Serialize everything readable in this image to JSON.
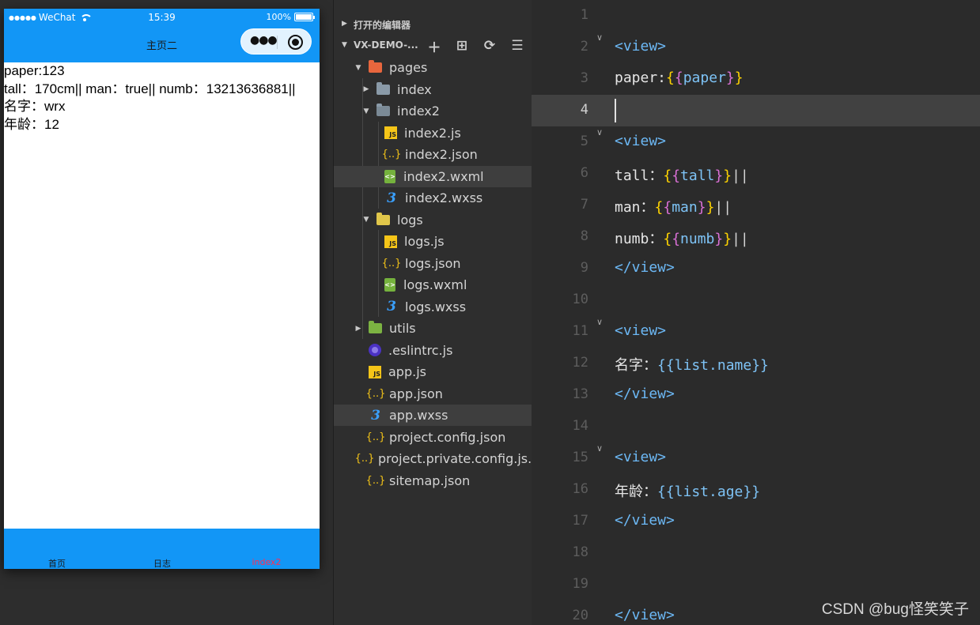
{
  "simulator": {
    "status": {
      "carrier": "WeChat",
      "time": "15:39",
      "battery": "100%"
    },
    "nav_title": "主页二",
    "content": [
      "paper:123",
      "tall：170cm|| man：true|| numb：13213636881||",
      "名字：wrx",
      "年龄：12"
    ],
    "tabs": [
      {
        "label": "首页",
        "active": false
      },
      {
        "label": "日志",
        "active": false
      },
      {
        "label": "index2",
        "active": true
      }
    ]
  },
  "explorer": {
    "section_open_editors": "打开的编辑器",
    "section_project": "VX-DEMO-...",
    "tree": [
      {
        "label": "pages",
        "icon": "folder-pages-icon",
        "depth": 1,
        "arrow": "down"
      },
      {
        "label": "index",
        "icon": "folder-icon",
        "depth": 2,
        "arrow": "right"
      },
      {
        "label": "index2",
        "icon": "folder-open-icon",
        "depth": 2,
        "arrow": "down"
      },
      {
        "label": "index2.js",
        "icon": "js-file-icon",
        "depth": 3
      },
      {
        "label": "index2.json",
        "icon": "json-file-icon",
        "depth": 3
      },
      {
        "label": "index2.wxml",
        "icon": "wxml-file-icon",
        "depth": 3,
        "selected": true
      },
      {
        "label": "index2.wxss",
        "icon": "css-file-icon",
        "depth": 3
      },
      {
        "label": "logs",
        "icon": "folder-logs-icon",
        "depth": 2,
        "arrow": "down"
      },
      {
        "label": "logs.js",
        "icon": "js-file-icon",
        "depth": 3
      },
      {
        "label": "logs.json",
        "icon": "json-file-icon",
        "depth": 3
      },
      {
        "label": "logs.wxml",
        "icon": "wxml-file-icon",
        "depth": 3
      },
      {
        "label": "logs.wxss",
        "icon": "css-file-icon",
        "depth": 3
      },
      {
        "label": "utils",
        "icon": "folder-utils-icon",
        "depth": 1,
        "arrow": "right"
      },
      {
        "label": ".eslintrc.js",
        "icon": "eslint-file-icon",
        "depth": 1
      },
      {
        "label": "app.js",
        "icon": "js-file-icon",
        "depth": 1
      },
      {
        "label": "app.json",
        "icon": "json-file-icon",
        "depth": 1
      },
      {
        "label": "app.wxss",
        "icon": "css-file-icon",
        "depth": 1,
        "hovered": true
      },
      {
        "label": "project.config.json",
        "icon": "json-file-icon",
        "depth": 1
      },
      {
        "label": "project.private.config.js...",
        "icon": "json-file-icon",
        "depth": 1
      },
      {
        "label": "sitemap.json",
        "icon": "json-file-icon",
        "depth": 1
      }
    ]
  },
  "editor": {
    "current_line": 4,
    "lines": [
      {
        "n": "1",
        "tokens": []
      },
      {
        "n": "2",
        "fold": true,
        "tokens": [
          [
            "tag",
            "<view>"
          ]
        ]
      },
      {
        "n": "3",
        "tokens": [
          [
            "txt",
            "paper:"
          ],
          [
            "b1",
            "{"
          ],
          [
            "b2",
            "{"
          ],
          [
            "var",
            "paper"
          ],
          [
            "b2",
            "}"
          ],
          [
            "b1",
            "}"
          ]
        ]
      },
      {
        "n": "4",
        "tokens": []
      },
      {
        "n": "5",
        "fold": true,
        "tokens": [
          [
            "tag",
            "<view>"
          ]
        ]
      },
      {
        "n": "6",
        "tokens": [
          [
            "txt",
            "tall："
          ],
          [
            "b1",
            "{"
          ],
          [
            "b2",
            "{"
          ],
          [
            "var",
            "tall"
          ],
          [
            "b2",
            "}"
          ],
          [
            "b1",
            "}"
          ],
          [
            "pipe",
            "||"
          ]
        ]
      },
      {
        "n": "7",
        "tokens": [
          [
            "txt",
            "man："
          ],
          [
            "b1",
            "{"
          ],
          [
            "b2",
            "{"
          ],
          [
            "var",
            "man"
          ],
          [
            "b2",
            "}"
          ],
          [
            "b1",
            "}"
          ],
          [
            "pipe",
            "||"
          ]
        ]
      },
      {
        "n": "8",
        "tokens": [
          [
            "txt",
            "numb："
          ],
          [
            "b1",
            "{"
          ],
          [
            "b2",
            "{"
          ],
          [
            "var",
            "numb"
          ],
          [
            "b2",
            "}"
          ],
          [
            "b1",
            "}"
          ],
          [
            "pipe",
            "||"
          ]
        ]
      },
      {
        "n": "9",
        "tokens": [
          [
            "tag",
            "</view>"
          ]
        ]
      },
      {
        "n": "10",
        "tokens": []
      },
      {
        "n": "11",
        "fold": true,
        "tokens": [
          [
            "tag",
            "<view>"
          ]
        ]
      },
      {
        "n": "12",
        "tokens": [
          [
            "txt",
            "名字："
          ],
          [
            "var",
            "{{list.name}}"
          ]
        ]
      },
      {
        "n": "13",
        "tokens": [
          [
            "tag",
            "</view>"
          ]
        ]
      },
      {
        "n": "14",
        "tokens": []
      },
      {
        "n": "15",
        "fold": true,
        "tokens": [
          [
            "tag",
            "<view>"
          ]
        ]
      },
      {
        "n": "16",
        "tokens": [
          [
            "txt",
            "年龄："
          ],
          [
            "var",
            "{{list.age}}"
          ]
        ]
      },
      {
        "n": "17",
        "tokens": [
          [
            "tag",
            "</view>"
          ]
        ]
      },
      {
        "n": "18",
        "tokens": []
      },
      {
        "n": "19",
        "tokens": []
      },
      {
        "n": "20",
        "tokens": [
          [
            "tag",
            "</view>"
          ]
        ]
      }
    ]
  },
  "watermark": "CSDN @bug怪笑笑子",
  "colors": {
    "wechat_blue": "#1296f6",
    "tab_active": "#ff2d55",
    "tag": "#6cb8f5",
    "bracket_outer": "#ffd400",
    "bracket_inner": "#da70d6"
  }
}
